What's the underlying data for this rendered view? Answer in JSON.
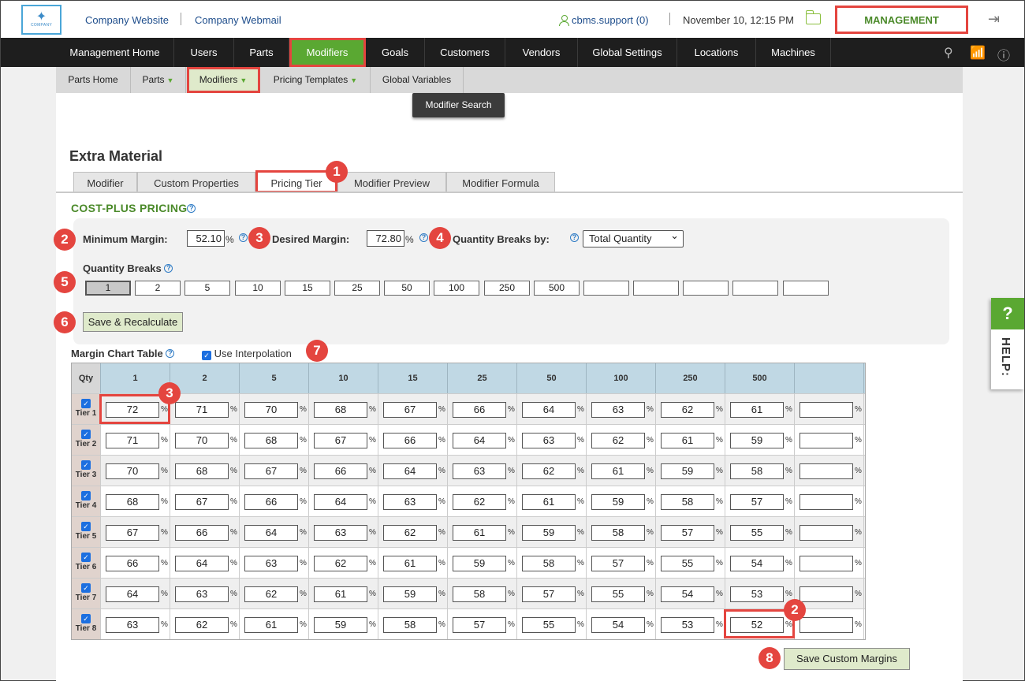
{
  "header": {
    "logo_text": "COMPANY",
    "links": [
      "Company Website",
      "Company Webmail"
    ],
    "user": "cbms.support (0)",
    "datetime": "November 10, 12:15 PM",
    "management": "MANAGEMENT"
  },
  "mainnav": [
    "Management Home",
    "Users",
    "Parts",
    "Modifiers",
    "Goals",
    "Customers",
    "Vendors",
    "Global Settings",
    "Locations",
    "Machines"
  ],
  "subnav": [
    "Parts Home",
    "Parts",
    "Modifiers",
    "Pricing Templates",
    "Global Variables"
  ],
  "dropdown_item": "Modifier Search",
  "page": {
    "title": "Extra Material",
    "tabs": [
      "Modifier",
      "Custom Properties",
      "Pricing Tier",
      "Modifier Preview",
      "Modifier Formula"
    ],
    "section": "COST-PLUS PRICING",
    "min_margin_label": "Minimum Margin:",
    "min_margin": "52.10",
    "desired_margin_label": "Desired Margin:",
    "desired_margin": "72.80",
    "qty_breaks_by_label": "Quantity Breaks by:",
    "qty_breaks_by": "Total Quantity",
    "qty_breaks_label": "Quantity Breaks",
    "qty_breaks": [
      "1",
      "2",
      "5",
      "10",
      "15",
      "25",
      "50",
      "100",
      "250",
      "500",
      "",
      "",
      "",
      "",
      ""
    ],
    "save_recalc": "Save & Recalculate",
    "margin_chart_label": "Margin Chart Table",
    "interp_label": "Use Interpolation",
    "save_custom": "Save Custom Margins",
    "pct": "%"
  },
  "table": {
    "qty_header": "Qty",
    "columns": [
      "1",
      "2",
      "5",
      "10",
      "15",
      "25",
      "50",
      "100",
      "250",
      "500",
      ""
    ],
    "rows": [
      {
        "tier": "Tier 1",
        "values": [
          "72",
          "71",
          "70",
          "68",
          "67",
          "66",
          "64",
          "63",
          "62",
          "61",
          ""
        ]
      },
      {
        "tier": "Tier 2",
        "values": [
          "71",
          "70",
          "68",
          "67",
          "66",
          "64",
          "63",
          "62",
          "61",
          "59",
          ""
        ]
      },
      {
        "tier": "Tier 3",
        "values": [
          "70",
          "68",
          "67",
          "66",
          "64",
          "63",
          "62",
          "61",
          "59",
          "58",
          ""
        ]
      },
      {
        "tier": "Tier 4",
        "values": [
          "68",
          "67",
          "66",
          "64",
          "63",
          "62",
          "61",
          "59",
          "58",
          "57",
          ""
        ]
      },
      {
        "tier": "Tier 5",
        "values": [
          "67",
          "66",
          "64",
          "63",
          "62",
          "61",
          "59",
          "58",
          "57",
          "55",
          ""
        ]
      },
      {
        "tier": "Tier 6",
        "values": [
          "66",
          "64",
          "63",
          "62",
          "61",
          "59",
          "58",
          "57",
          "55",
          "54",
          ""
        ]
      },
      {
        "tier": "Tier 7",
        "values": [
          "64",
          "63",
          "62",
          "61",
          "59",
          "58",
          "57",
          "55",
          "54",
          "53",
          ""
        ]
      },
      {
        "tier": "Tier 8",
        "values": [
          "63",
          "62",
          "61",
          "59",
          "58",
          "57",
          "55",
          "54",
          "53",
          "52",
          ""
        ]
      }
    ]
  },
  "badges": {
    "b1": "1",
    "b2": "2",
    "b3": "3",
    "b4": "4",
    "b5": "5",
    "b6": "6",
    "b7": "7",
    "b8": "8"
  },
  "help": {
    "q": "?",
    "label": "HELP:"
  },
  "colors": {
    "accent_green": "#5aa832",
    "highlight_red": "#e4453f",
    "nav_dark": "#1e1e1e",
    "table_header": "#c0d8e4"
  }
}
